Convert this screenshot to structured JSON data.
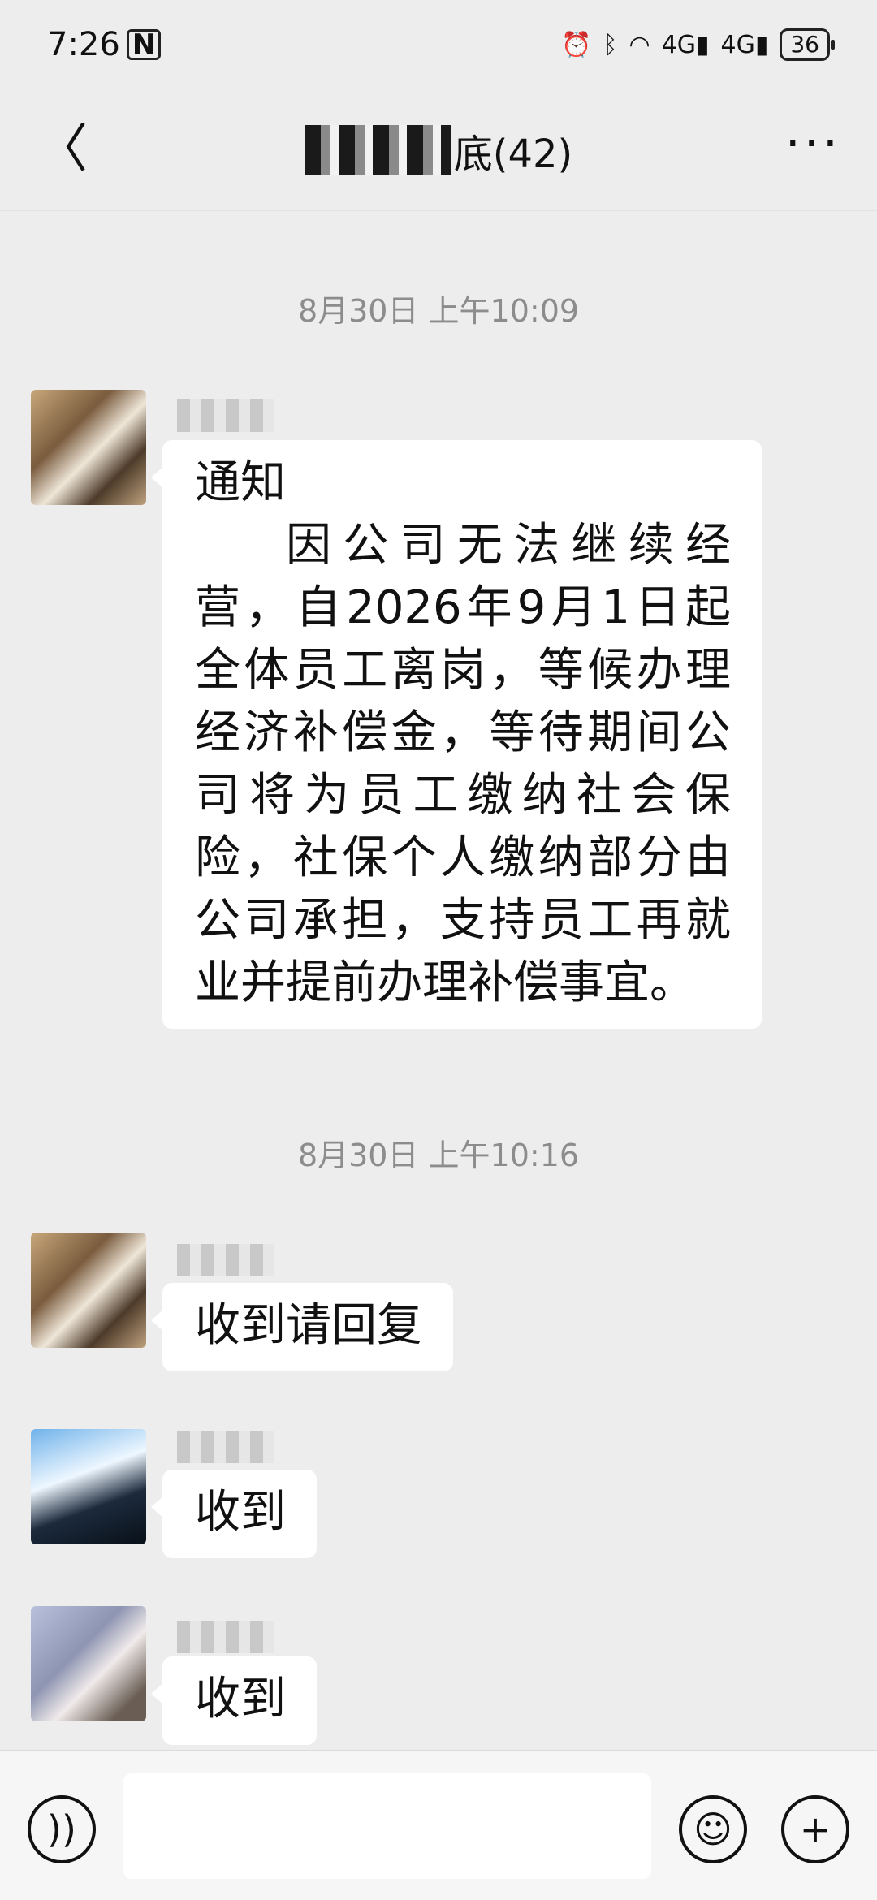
{
  "status_bar": {
    "time": "7:26",
    "nfc_glyph": "N",
    "battery": "36",
    "net1": "4G",
    "net2": "4G"
  },
  "header": {
    "title_visible": "底(42)"
  },
  "messages": [
    {
      "timestamp": "8月30日 上午10:09",
      "title": "通知",
      "body": "因公司无法继续经营，自2026年9月1日起全体员工离岗，等候办理经济补偿金，等待期间公司将为员工缴纳社会保险，社保个人缴纳部分由公司承担，支持员工再就业并提前办理补偿事宜。"
    },
    {
      "timestamp": "8月30日 上午10:16",
      "text": "收到请回复"
    },
    {
      "text": "收到"
    },
    {
      "text": "收到"
    }
  ],
  "input_bar": {
    "placeholder": ""
  }
}
